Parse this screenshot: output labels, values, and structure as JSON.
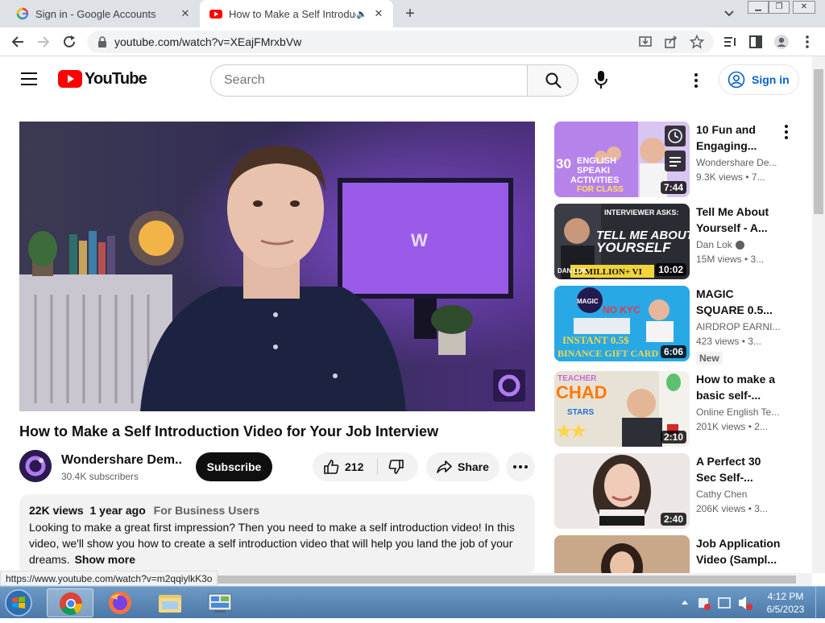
{
  "browser": {
    "tabs": [
      {
        "title": "Sign in - Google Accounts",
        "active": false
      },
      {
        "title": "How to Make a Self Introduc",
        "active": true
      }
    ],
    "address": "youtube.com/watch?v=XEajFMrxbVw",
    "status_url": "https://www.youtube.com/watch?v=m2qqiylkK3o"
  },
  "youtube": {
    "logo_text": "YouTube",
    "search_placeholder": "Search",
    "signin_label": "Sign in"
  },
  "video": {
    "title": "How to Make a Self Introduction Video for Your Job Interview",
    "channel": "Wondershare Dem...",
    "subscribers": "30.4K subscribers",
    "subscribe_label": "Subscribe",
    "likes": "212",
    "share_label": "Share",
    "views": "22K views",
    "age": "1 year ago",
    "category": "For Business Users",
    "description": "Looking to make a great first impression? Then you need to make a self introduction video! In this video, we'll show you how to create a self introduction video that will help you land the job of your dreams.",
    "show_more": "Show more"
  },
  "recommendations": [
    {
      "title": "10 Fun and Engaging...",
      "channel": "Wondershare De...",
      "meta": "9.3K views  •  7...",
      "duration": "7:44",
      "thumb_text": [
        "30",
        "ENGLISH",
        "SPEAKI",
        "ACTIVITIES",
        "FOR CLASS"
      ]
    },
    {
      "title": "Tell Me About Yourself - A...",
      "channel": "Dan Lok",
      "meta": "15M views  •  3...",
      "duration": "10:02",
      "thumb_text": [
        "INTERVIEWER ASKS:",
        "TELL ME ABOUT",
        "YOURSELF",
        "10 MILLION+ VI",
        "DAN LOK"
      ]
    },
    {
      "title": "MAGIC SQUARE 0.5...",
      "channel": "AIRDROP EARNI...",
      "meta": "423 views  •  3...",
      "duration": "6:06",
      "badge": "New",
      "thumb_text": [
        "MAGIC",
        "NO KYC",
        "INSTANT 0.5$",
        "BINANCE GIFT CARD"
      ]
    },
    {
      "title": "How to make a basic self-...",
      "channel": "Online English Te...",
      "meta": "201K views  •  2...",
      "duration": "2:10",
      "thumb_text": [
        "TEACHER",
        "CHAD",
        "STARS"
      ]
    },
    {
      "title": "A Perfect 30 Sec Self-...",
      "channel": "Cathy Chen",
      "meta": "206K views  •  3...",
      "duration": "2:40"
    },
    {
      "title": "Job Application Video (Sampl...",
      "channel": "",
      "meta": "",
      "duration": ""
    }
  ],
  "taskbar": {
    "time": "4:12 PM",
    "date": "6/5/2023"
  },
  "colors": {
    "yt_red": "#ff0000",
    "link_blue": "#065fd4",
    "chrome_frame": "#dee1e6"
  }
}
